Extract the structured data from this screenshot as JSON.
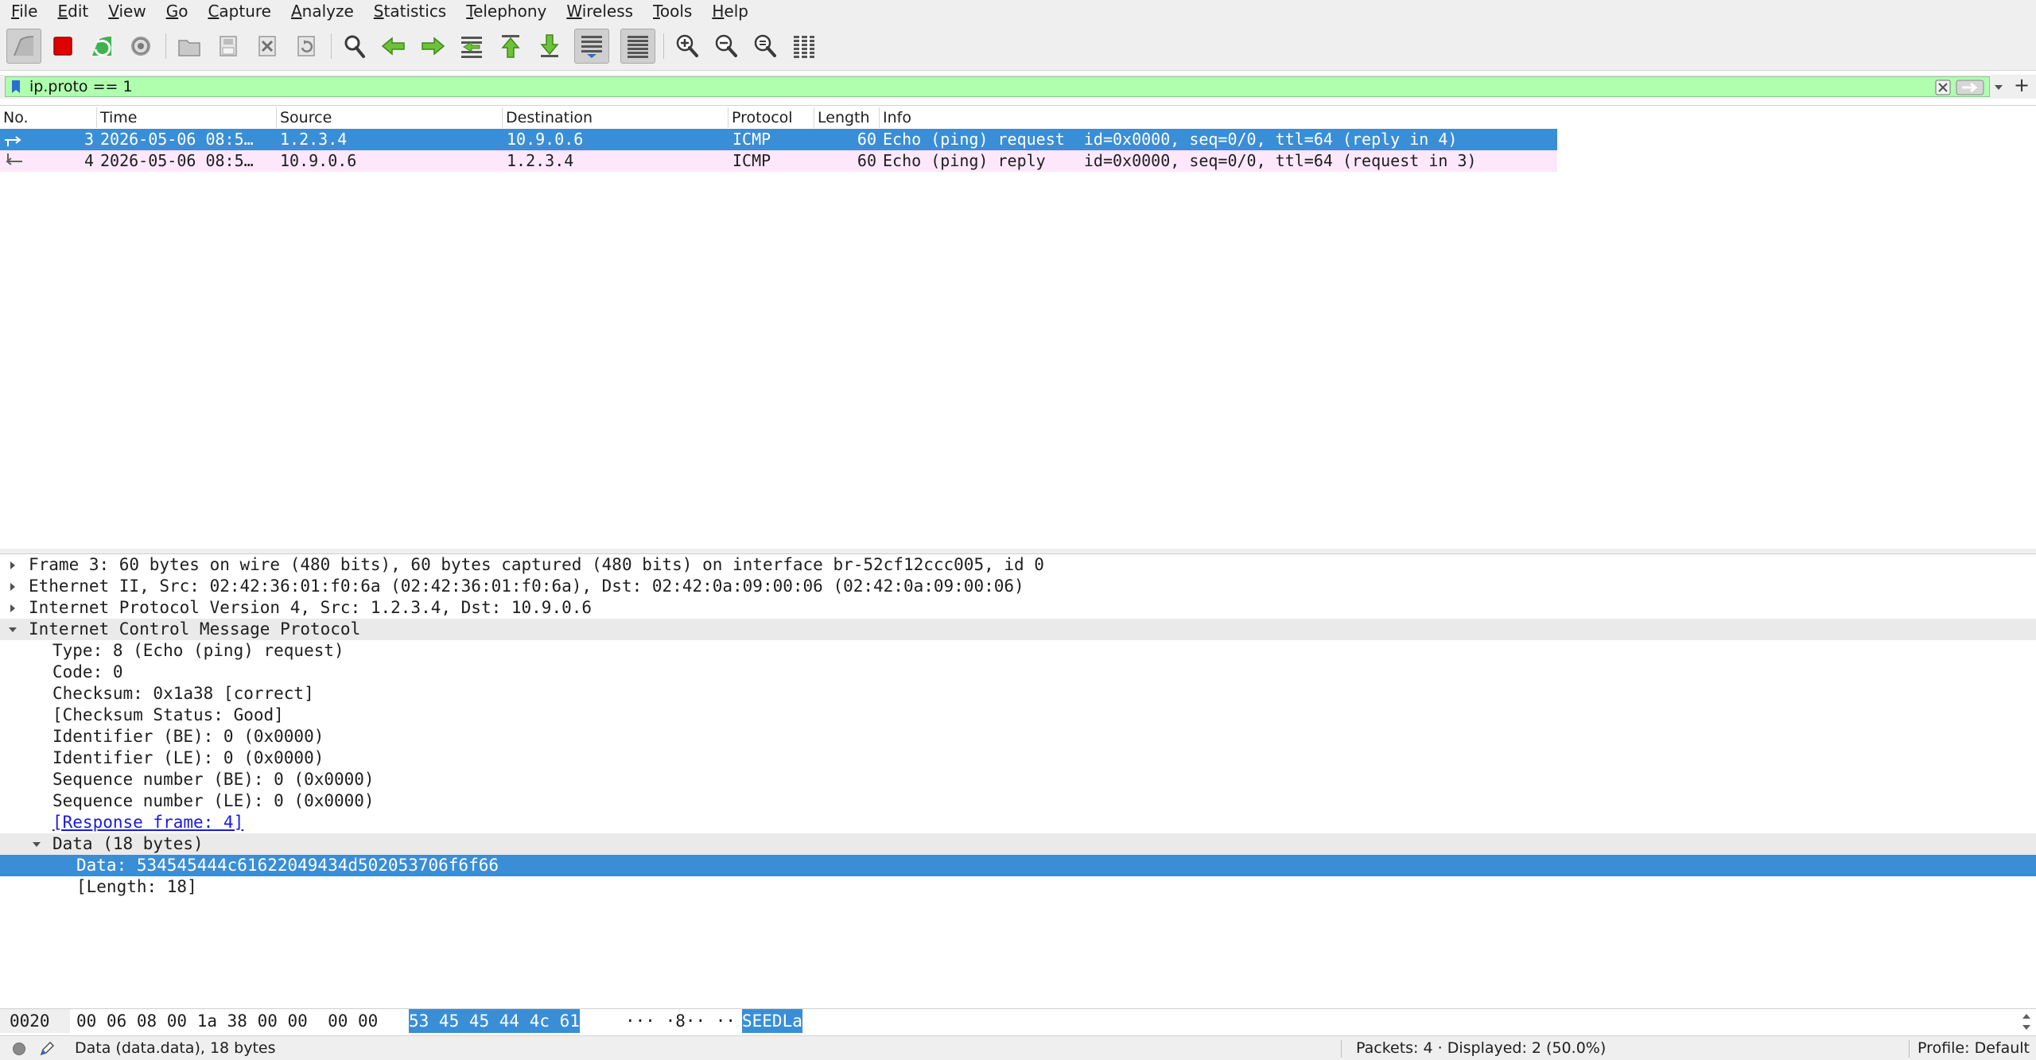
{
  "menu": [
    "File",
    "Edit",
    "View",
    "Go",
    "Capture",
    "Analyze",
    "Statistics",
    "Telephony",
    "Wireless",
    "Tools",
    "Help"
  ],
  "colors": {
    "filter_valid": "#afffaf",
    "selection": "#3a8ed6",
    "icmp_row": "#fde8fb",
    "stop_red": "#e00000"
  },
  "toolbar": {
    "icons": [
      "shark-fin-start-icon",
      "stop-capture-icon",
      "restart-capture-icon",
      "capture-options-icon",
      "open-file-icon",
      "save-file-icon",
      "close-file-icon",
      "reload-file-icon",
      "find-packet-icon",
      "go-back-icon",
      "go-forward-icon",
      "go-to-packet-icon",
      "first-packet-icon",
      "last-packet-icon",
      "autoscroll-icon",
      "colorize-icon",
      "zoom-in-icon",
      "zoom-out-icon",
      "normal-size-icon",
      "resize-columns-icon"
    ]
  },
  "filter": {
    "value": "ip.proto == 1",
    "add_label": "+"
  },
  "packet_list": {
    "columns": [
      "No.",
      "Time",
      "Source",
      "Destination",
      "Protocol",
      "Length",
      "Info"
    ],
    "rows": [
      {
        "no": "3",
        "time": "2026-05-06 08:5…",
        "source": "1.2.3.4",
        "destination": "10.9.0.6",
        "protocol": "ICMP",
        "length": "60",
        "info": "Echo (ping) request  id=0x0000, seq=0/0, ttl=64 (reply in 4)",
        "selected": true
      },
      {
        "no": "4",
        "time": "2026-05-06 08:5…",
        "source": "10.9.0.6",
        "destination": "1.2.3.4",
        "protocol": "ICMP",
        "length": "60",
        "info": "Echo (ping) reply    id=0x0000, seq=0/0, ttl=64 (request in 3)",
        "selected": false
      }
    ]
  },
  "details": {
    "frame": "Frame 3: 60 bytes on wire (480 bits), 60 bytes captured (480 bits) on interface br-52cf12ccc005, id 0",
    "ethernet": "Ethernet II, Src: 02:42:36:01:f0:6a (02:42:36:01:f0:6a), Dst: 02:42:0a:09:00:06 (02:42:0a:09:00:06)",
    "ip": "Internet Protocol Version 4, Src: 1.2.3.4, Dst: 10.9.0.6",
    "icmp": "Internet Control Message Protocol",
    "icmp_fields": [
      "Type: 8 (Echo (ping) request)",
      "Code: 0",
      "Checksum: 0x1a38 [correct]",
      "[Checksum Status: Good]",
      "Identifier (BE): 0 (0x0000)",
      "Identifier (LE): 0 (0x0000)",
      "Sequence number (BE): 0 (0x0000)",
      "Sequence number (LE): 0 (0x0000)"
    ],
    "response_link": "[Response frame: 4]",
    "data_section": "Data (18 bytes)",
    "data_value": "Data: 534545444c61622049434d502053706f6f66",
    "data_length": "[Length: 18]"
  },
  "bytes": {
    "offset": "0020",
    "hex_plain": "00 06 08 00 1a 38 00 00  00 00",
    "hex_selected": "53 45 45 44 4c 61",
    "ascii_plain": "··· ·8·· ··",
    "ascii_selected": "SEEDLa"
  },
  "status": {
    "field": "Data (data.data), 18 bytes",
    "packets": "Packets: 4 · Displayed: 2 (50.0%)",
    "profile": "Profile: Default"
  }
}
